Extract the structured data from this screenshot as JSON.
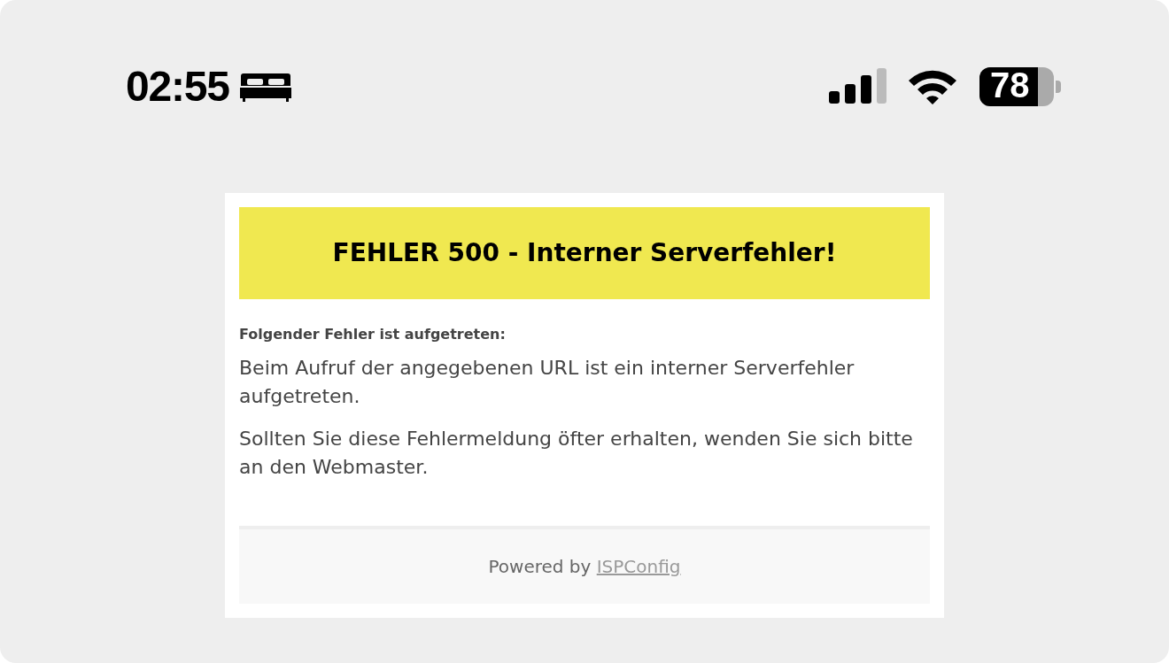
{
  "status_bar": {
    "time": "02:55",
    "battery": "78"
  },
  "error_page": {
    "title": "FEHLER 500 - Interner Serverfehler!",
    "label": "Folgender Fehler ist aufgetreten:",
    "paragraphs": [
      "Beim Aufruf der angegebenen URL ist ein interner Serverfehler aufgetreten.",
      "Sollten Sie diese Fehlermeldung öfter erhalten, wenden Sie sich bitte an den Webmaster."
    ],
    "footer": {
      "text": "Powered by",
      "link": "ISPConfig"
    }
  }
}
